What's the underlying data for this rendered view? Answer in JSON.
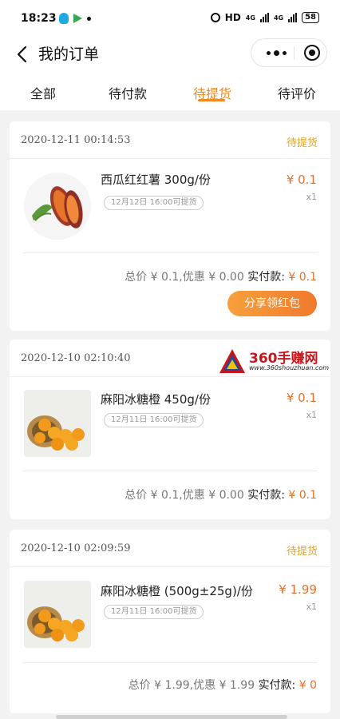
{
  "status_bar": {
    "time": "18:23",
    "right_text": "HD",
    "network_1": "4G",
    "network_2": "4G",
    "battery": "58"
  },
  "header": {
    "title": "我的订单"
  },
  "tabs": [
    {
      "label": "全部",
      "active": false
    },
    {
      "label": "待付款",
      "active": false
    },
    {
      "label": "待提货",
      "active": true
    },
    {
      "label": "待评价",
      "active": false
    }
  ],
  "colors": {
    "accent": "#f08a24",
    "status": "#e0a32a",
    "price": "#e2722c"
  },
  "orders": [
    {
      "date": "2020-12-11 00:14:53",
      "status": "待提货",
      "product": "西瓜红红薯 300g/份",
      "pickup": "12月12日 16:00可提货",
      "price": "¥ 0.1",
      "qty": "x1",
      "summary_prefix": "总价 ¥ 0.1,优惠 ¥ 0.00",
      "paid_label": "实付款:",
      "paid": "¥ 0.1",
      "share_button": "分享领红包",
      "image": "sweet-potato"
    },
    {
      "date": "2020-12-10 02:10:40",
      "status": "",
      "product": "麻阳冰糖橙 450g/份",
      "pickup": "12月11日 16:00可提货",
      "price": "¥ 0.1",
      "qty": "x1",
      "summary_prefix": "总价 ¥ 0.1,优惠 ¥ 0.00",
      "paid_label": "实付款:",
      "paid": "¥ 0.1",
      "image": "oranges"
    },
    {
      "date": "2020-12-10 02:09:59",
      "status": "待提货",
      "product": "麻阳冰糖橙 (500g±25g)/份",
      "pickup": "12月11日 16:00可提货",
      "price": "¥ 1.99",
      "qty": "x1",
      "summary_prefix": "总价 ¥ 1.99,优惠 ¥ 1.99",
      "paid_label": "实付款:",
      "paid": "¥ 0",
      "image": "oranges"
    }
  ],
  "watermark": {
    "brand": "360手赚网",
    "url": "www.360shouzhuan.com"
  }
}
